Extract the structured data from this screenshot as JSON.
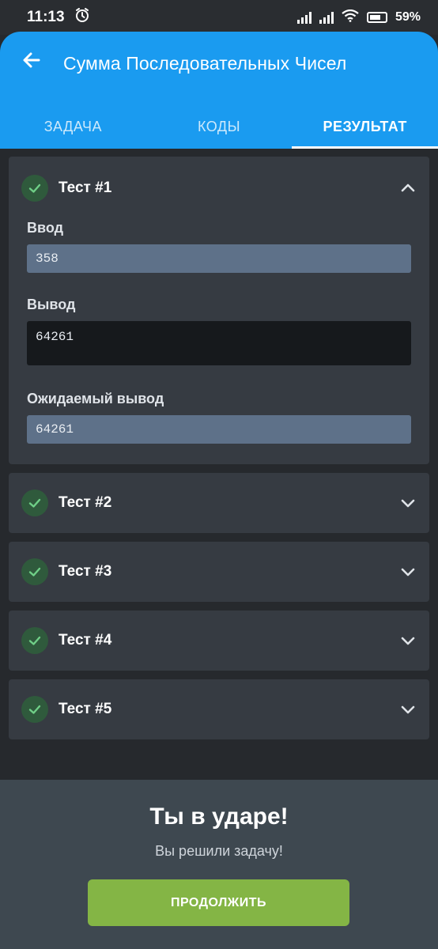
{
  "status_bar": {
    "time": "11:13",
    "battery": "59%"
  },
  "header": {
    "title": "Сумма Последовательных Чисел",
    "back_icon": "arrow-left-icon"
  },
  "tabs": [
    {
      "label": "ЗАДАЧА",
      "active": false
    },
    {
      "label": "КОДЫ",
      "active": false
    },
    {
      "label": "РЕЗУЛЬТАТ",
      "active": true
    }
  ],
  "tests": [
    {
      "title": "Тест #1",
      "passed": true,
      "expanded": true,
      "input_label": "Ввод",
      "input_value": "358",
      "output_label": "Вывод",
      "output_value": "64261",
      "expected_label": "Ожидаемый вывод",
      "expected_value": "64261"
    },
    {
      "title": "Тест #2",
      "passed": true,
      "expanded": false
    },
    {
      "title": "Тест #3",
      "passed": true,
      "expanded": false
    },
    {
      "title": "Тест #4",
      "passed": true,
      "expanded": false
    },
    {
      "title": "Тест #5",
      "passed": true,
      "expanded": false
    }
  ],
  "result": {
    "title": "Ты в ударе!",
    "subtitle": "Вы решили задачу!",
    "button_label": "ПРОДОЛЖИТЬ"
  },
  "colors": {
    "header": "#1a9bf0",
    "background": "#26292d",
    "card": "#363b42",
    "check_bg": "#2f5a3c",
    "check_mark": "#6fcf87",
    "field_light": "#5e7189",
    "field_dark": "#16191c",
    "button": "#84b545"
  }
}
